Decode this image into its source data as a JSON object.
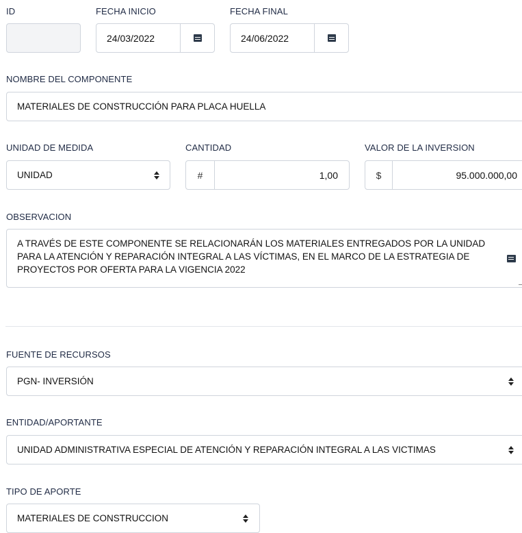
{
  "labels": {
    "id": "ID",
    "fecha_inicio": "FECHA INICIO",
    "fecha_final": "FECHA FINAL",
    "nombre_componente": "NOMBRE DEL COMPONENTE",
    "unidad_medida": "UNIDAD DE MEDIDA",
    "cantidad": "CANTIDAD",
    "valor_inversion": "VALOR DE LA INVERSION",
    "observacion": "OBSERVACION",
    "fuente_recursos": "FUENTE DE RECURSOS",
    "entidad_aportante": "ENTIDAD/APORTANTE",
    "tipo_aporte": "TIPO DE APORTE"
  },
  "fields": {
    "id": "",
    "fecha_inicio": "24/03/2022",
    "fecha_final": "24/06/2022",
    "nombre_componente": "MATERIALES DE CONSTRUCCIÓN PARA PLACA HUELLA",
    "unidad_medida": "UNIDAD",
    "cantidad_prefix": "#",
    "cantidad": "1,00",
    "valor_prefix": "$",
    "valor_inversion": "95.000.000,00",
    "observacion_lines": [
      "A TRAVÉS DE ESTE COMPONENTE SE RELACIONARÁN LOS MATERIALES ENTREGADOS POR LA UNIDAD",
      "PARA LA ATENCIÓN Y REPARACIÓN INTEGRAL A LAS VÍCTIMAS, EN EL MARCO DE LA ESTRATEGIA DE",
      "PROYECTOS POR OFERTA PARA LA VIGENCIA 2022"
    ],
    "fuente_recursos": "PGN- INVERSIÓN",
    "entidad_aportante": "UNIDAD ADMINISTRATIVA ESPECIAL DE ATENCIÓN Y REPARACIÓN INTEGRAL A LAS VICTIMAS",
    "tipo_aporte": "MATERIALES DE CONSTRUCCION"
  },
  "icons": {
    "date_picker": "calendar-icon",
    "select": "select-arrows-icon",
    "textarea": "note-icon"
  },
  "colors": {
    "border": "#cfd4dc",
    "label": "#1f2a44",
    "readonly_bg": "#f3f4f6"
  }
}
